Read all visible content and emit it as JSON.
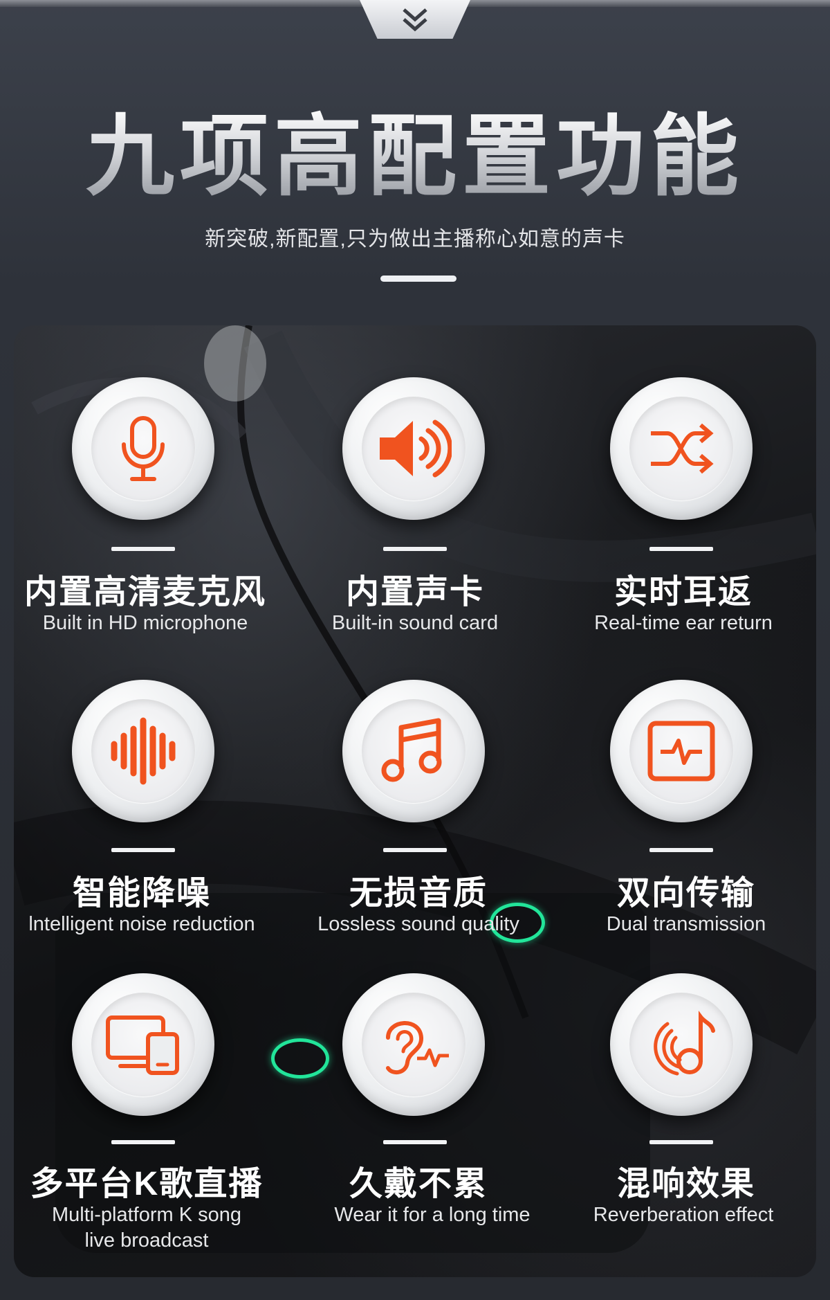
{
  "header": {
    "title": "九项高配置功能",
    "subtitle": "新突破,新配置,只为做出主播称心如意的声卡",
    "tab_icon": "double-chevron-down-icon"
  },
  "colors": {
    "accent": "#f0531f",
    "background": "#2e323a",
    "panel": "#141518",
    "indicator_ring": "#22e59a"
  },
  "features": [
    {
      "cn": "内置高清麦克风",
      "en": "Built in HD microphone",
      "icon": "microphone-icon"
    },
    {
      "cn": "内置声卡",
      "en": "Built-in sound card",
      "icon": "speaker-icon"
    },
    {
      "cn": "实时耳返",
      "en": "Real-time ear return",
      "icon": "shuffle-icon"
    },
    {
      "cn": "智能降噪",
      "en": "lntelligent noise reduction",
      "icon": "sound-wave-icon"
    },
    {
      "cn": "无损音质",
      "en": "Lossless sound quality",
      "icon": "music-note-icon"
    },
    {
      "cn": "双向传输",
      "en": "Dual transmission",
      "icon": "pulse-monitor-icon"
    },
    {
      "cn": "多平台K歌直播",
      "en": "Multi-platform K song",
      "en2": "live broadcast",
      "icon": "devices-icon"
    },
    {
      "cn": "久戴不累",
      "en": "Wear it for a long time",
      "icon": "ear-icon"
    },
    {
      "cn": "混响效果",
      "en": "Reverberation effect",
      "icon": "reverb-note-icon"
    }
  ]
}
